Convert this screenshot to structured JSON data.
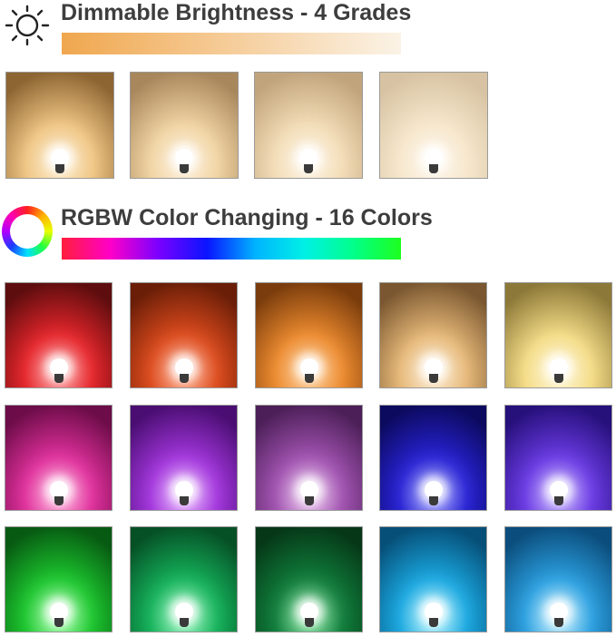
{
  "brightness": {
    "title": "Dimmable Brightness - 4 Grades",
    "icon": "sun-icon",
    "bar_colors": [
      "#f0a74e",
      "#fbf3e6"
    ],
    "panels": [
      {
        "center": "#fde7c0",
        "mid": "#f0c684",
        "edge": "#8d6532"
      },
      {
        "center": "#fdebcf",
        "mid": "#f1d4a3",
        "edge": "#a8875c"
      },
      {
        "center": "#fdf0da",
        "mid": "#f3ddb7",
        "edge": "#c1a47c"
      },
      {
        "center": "#fef5e6",
        "mid": "#f7e7cc",
        "edge": "#d7c3a3"
      }
    ]
  },
  "colors": {
    "title": "RGBW Color Changing - 16 Colors",
    "icon": "color-wheel-icon",
    "bar_colors": [
      "#ff1e3c",
      "#ff00c8",
      "#7a00ff",
      "#0a14ff",
      "#00b4ff",
      "#00f0e6",
      "#00ff8c",
      "#1eff1e"
    ],
    "panels": [
      {
        "center": "#ff8a8a",
        "mid": "#e5252b",
        "edge": "#5e0d0e"
      },
      {
        "center": "#ff9a75",
        "mid": "#dc4a1c",
        "edge": "#6a1e08"
      },
      {
        "center": "#ffc17c",
        "mid": "#ec8a2e",
        "edge": "#7a3c0c"
      },
      {
        "center": "#fde5c2",
        "mid": "#e6b878",
        "edge": "#7a5730"
      },
      {
        "center": "#fff4c8",
        "mid": "#f4dc86",
        "edge": "#8c7838"
      },
      {
        "center": "#ff9ad2",
        "mid": "#e0309c",
        "edge": "#6c0c48"
      },
      {
        "center": "#e2a0ff",
        "mid": "#a235dc",
        "edge": "#4a0e72"
      },
      {
        "center": "#e3b4e9",
        "mid": "#a152b0",
        "edge": "#4c1f58"
      },
      {
        "center": "#8a8cff",
        "mid": "#2722d4",
        "edge": "#0c0a5e"
      },
      {
        "center": "#b59bff",
        "mid": "#6a3ae4",
        "edge": "#26107a"
      },
      {
        "center": "#8cff94",
        "mid": "#1cc62e",
        "edge": "#075a12"
      },
      {
        "center": "#7ff5b0",
        "mid": "#14b25a",
        "edge": "#065026"
      },
      {
        "center": "#6be08e",
        "mid": "#0f7d3a",
        "edge": "#063818"
      },
      {
        "center": "#a6f4ff",
        "mid": "#1aa8e0",
        "edge": "#064f78"
      },
      {
        "center": "#b2ecff",
        "mid": "#2ba0e0",
        "edge": "#0b4d7c"
      }
    ]
  }
}
